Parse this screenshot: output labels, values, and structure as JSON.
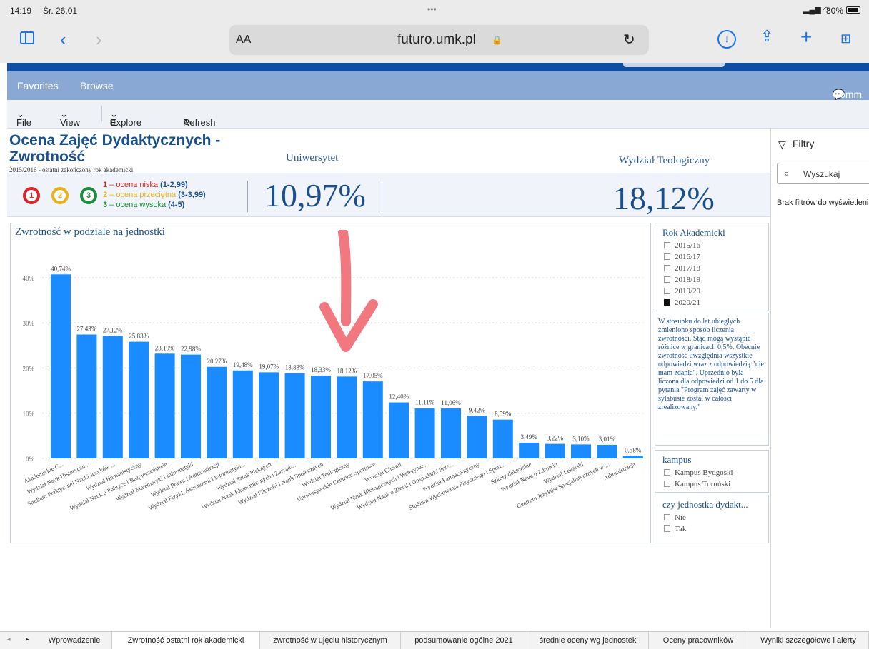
{
  "status": {
    "time": "14:19",
    "date": "Śr. 26.01",
    "dots": "•••",
    "battery": "80%"
  },
  "safari": {
    "text_size": "AA",
    "url": "futuro.umk.pl"
  },
  "nav": {
    "favorites": "Favorites",
    "browse": "Browse",
    "comments": "Comm"
  },
  "toolbar": {
    "file": "File",
    "view": "View",
    "explore": "Explore",
    "refresh": "Refresh"
  },
  "report": {
    "title": "Ocena Zajęć Dydaktycznych - Zwrotność",
    "subtitle": "2015/2016 - ostatni zakończony rok akademicki",
    "col_uni": "Uniwersytet",
    "col_faculty": "Wydział Teologiczny",
    "kpi_uni": "10,97%",
    "kpi_faculty": "18,12%",
    "legend": [
      {
        "num": "1",
        "label": " – ocena niska ",
        "range": "(1-2,99)",
        "color": "#d8262a"
      },
      {
        "num": "2",
        "label": " – ocena przeciętna ",
        "range": "(3-3,99)",
        "color": "#e8b21c"
      },
      {
        "num": "3",
        "label": " – ocena wysoka ",
        "range": "(4-5)",
        "color": "#1e8e3e"
      }
    ]
  },
  "chart_data": {
    "type": "bar",
    "title": "Zwrotność w podziale na jednostki",
    "categories": [
      "Akademickie C...",
      "Wydział Nauk Historyczn...",
      "Studium Praktycznej Nauki Języków ...",
      "Wydział Humanistyczny",
      "Wydział Nauk o Polityce i Bezpieczeństwie",
      "Wydział Matematyki i Informatyki",
      "Wydział Prawa i Administracji",
      "Wydział Fizyki, Astronomii i Informatyki...",
      "Wydział Sztuk Pięknych",
      "Wydział Nauk Ekonomicznych i Zarządz...",
      "Wydział Filozofii i Nauk Społecznych",
      "Wydział Teologiczny",
      "Uniwersyteckie Centrum Sportowe",
      "Wydział Chemii",
      "Wydział Nauk Biologicznych i Weterynar...",
      "Wydział Nauk o Ziemi i Gospodarki Prze...",
      "Wydział Farmaceutyczny",
      "Studium Wychowania Fizycznego i Sport...",
      "Szkoły doktorskie",
      "Wydział Nauk o Zdrowiu",
      "Wydział Lekarski",
      "Centrum Języków Specjalistycznych w ...",
      "Administracja"
    ],
    "values": [
      40.74,
      27.43,
      27.12,
      25.83,
      23.19,
      22.98,
      20.27,
      19.48,
      19.07,
      18.88,
      18.33,
      18.12,
      17.05,
      12.4,
      11.11,
      11.06,
      9.42,
      8.59,
      3.49,
      3.22,
      3.1,
      3.01,
      0.58
    ],
    "labels": [
      "40,74%",
      "27,43%",
      "27,12%",
      "25,83%",
      "23,19%",
      "22,98%",
      "20,27%",
      "19,48%",
      "19,07%",
      "18,88%",
      "18,33%",
      "18,12%",
      "17,05%",
      "12,40%",
      "11,11%",
      "11,06%",
      "9,42%",
      "8,59%",
      "3,49%",
      "3,22%",
      "3,10%",
      "3,01%",
      "0,58%"
    ],
    "yticks": [
      "0%",
      "10%",
      "20%",
      "30%",
      "40%"
    ],
    "ylim": [
      0,
      43
    ],
    "bar_color": "#1a8cff",
    "grid": true
  },
  "rok": {
    "title": "Rok Akademicki",
    "years": [
      {
        "label": "2015/16",
        "checked": false
      },
      {
        "label": "2016/17",
        "checked": false
      },
      {
        "label": "2017/18",
        "checked": false
      },
      {
        "label": "2018/19",
        "checked": false
      },
      {
        "label": "2019/20",
        "checked": false
      },
      {
        "label": "2020/21",
        "checked": true
      }
    ]
  },
  "note": "W stosunku do lat ubiegłych zmieniono sposób liczenia zwrotności. Stąd mogą wystąpić różnice w granicach 0,5%. Obecnie zwrotność uwzględnia wszystkie odpowiedzi wraz z odpowiedzią \"nie mam zdania\". Uprzednio była liczona dla odpowiedzi od 1 do 5 dla pytania \"Program zajęć zawarty w sylabusie został w całości zrealizowany.\"",
  "kampus": {
    "title": "kampus",
    "items": [
      "Kampus Bydgoski",
      "Kampus Toruński"
    ]
  },
  "dydakt": {
    "title": "czy jednostka dydakt...",
    "items": [
      "Nie",
      "Tak"
    ]
  },
  "filters": {
    "title": "Filtry",
    "search_placeholder": "Wyszukaj",
    "empty": "Brak filtrów do wyświetlenia"
  },
  "tabs": [
    "Wprowadzenie",
    "Zwrotność ostatni rok akademicki",
    "zwrotność w ujęciu historycznym",
    "podsumowanie ogólne 2021",
    "średnie oceny wg jednostek",
    "Oceny pracowników",
    "Wyniki szczegółowe i alerty"
  ]
}
